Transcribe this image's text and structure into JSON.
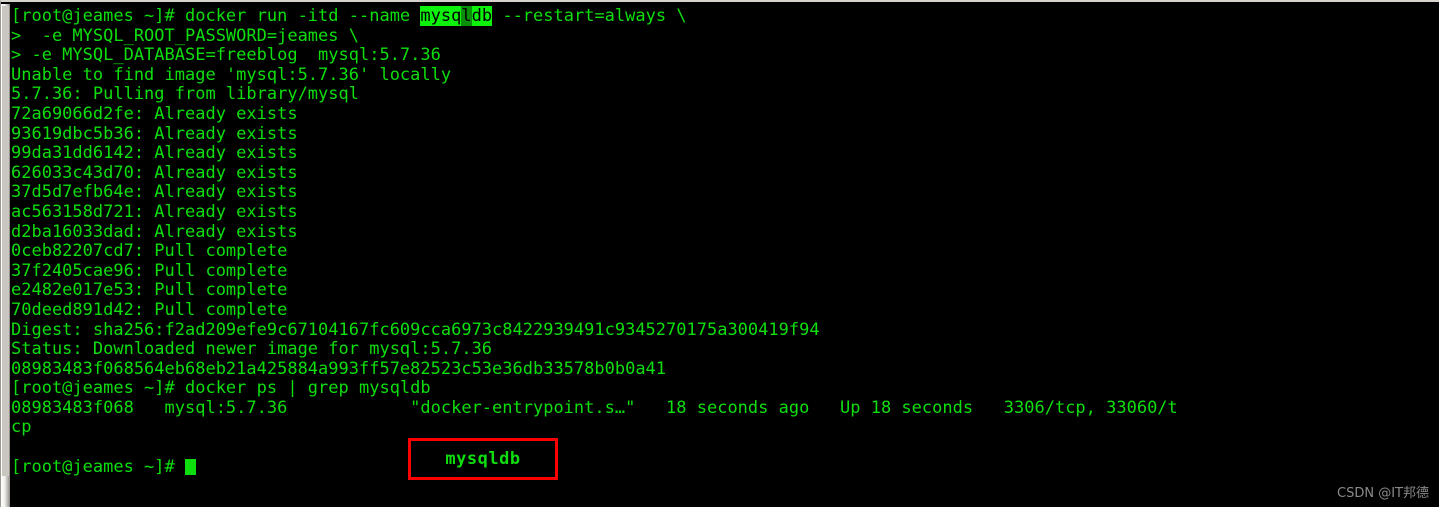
{
  "terminal": {
    "prompt": "[root@jeames ~]#",
    "continuation_prompt": ">",
    "lines": [
      {
        "id": "cmd-docker-run",
        "text": "[root@jeames ~]# docker run -itd --name "
      },
      {
        "id": "cont-password",
        "text": ">  -e MYSQL_ROOT_PASSWORD=jeames \\"
      },
      {
        "id": "cont-database",
        "text": "> -e MYSQL_DATABASE=freeblog  mysql:5.7.36"
      },
      {
        "id": "out-unable-to-find",
        "text": "Unable to find image 'mysql:5.7.36' locally"
      },
      {
        "id": "out-pulling",
        "text": "5.7.36: Pulling from library/mysql"
      },
      {
        "id": "layer-1",
        "text": "72a69066d2fe: Already exists"
      },
      {
        "id": "layer-2",
        "text": "93619dbc5b36: Already exists"
      },
      {
        "id": "layer-3",
        "text": "99da31dd6142: Already exists"
      },
      {
        "id": "layer-4",
        "text": "626033c43d70: Already exists"
      },
      {
        "id": "layer-5",
        "text": "37d5d7efb64e: Already exists"
      },
      {
        "id": "layer-6",
        "text": "ac563158d721: Already exists"
      },
      {
        "id": "layer-7",
        "text": "d2ba16033dad: Already exists"
      },
      {
        "id": "layer-8",
        "text": "0ceb82207cd7: Pull complete"
      },
      {
        "id": "layer-9",
        "text": "37f2405cae96: Pull complete"
      },
      {
        "id": "layer-10",
        "text": "e2482e017e53: Pull complete"
      },
      {
        "id": "layer-11",
        "text": "70deed891d42: Pull complete"
      },
      {
        "id": "out-digest",
        "text": "Digest: sha256:f2ad209efe9c67104167fc609cca6973c8422939491c9345270175a300419f94"
      },
      {
        "id": "out-status",
        "text": "Status: Downloaded newer image for mysql:5.7.36"
      },
      {
        "id": "out-container-id",
        "text": "08983483f068564eb68eb21a425884a993ff57e82523c53e36db33578b0b0a41"
      },
      {
        "id": "cmd-docker-ps",
        "text": "[root@jeames ~]# docker ps | grep mysqldb"
      },
      {
        "id": "ps-row",
        "text": "08983483f068   mysql:5.7.36            \"docker-entrypoint.s…\"   18 seconds ago   Up 18 seconds   3306/tcp, 33060/t"
      },
      {
        "id": "ps-row-wrap",
        "text": "cp"
      },
      {
        "id": "blank-line",
        "text": " "
      },
      {
        "id": "cmd-final-prompt",
        "text": "[root@jeames ~]# "
      }
    ],
    "command_line_1": {
      "prefix": "[root@jeames ~]# docker run -itd --name ",
      "highlight_before": "mysq",
      "highlight_cursor": "l",
      "highlight_after": "db",
      "suffix": " --restart=always \\"
    },
    "docker_ps_row": {
      "container_id": "08983483f068",
      "image": "mysql:5.7.36",
      "command": "\"docker-entrypoint.s…\"",
      "created": "18 seconds ago",
      "status": "Up 18 seconds",
      "ports": "3306/tcp, 33060/tcp"
    }
  },
  "annotation": {
    "label": "mysqldb",
    "border_color": "#fe0000",
    "text_color": "#0ede0e"
  },
  "watermark": {
    "text": "CSDN @IT邦德"
  },
  "colors": {
    "background": "#000000",
    "foreground": "#0ede0e",
    "highlight_background": "#0cf20c",
    "highlight_foreground": "#000000",
    "scrollbar": "#c9c6c0"
  }
}
